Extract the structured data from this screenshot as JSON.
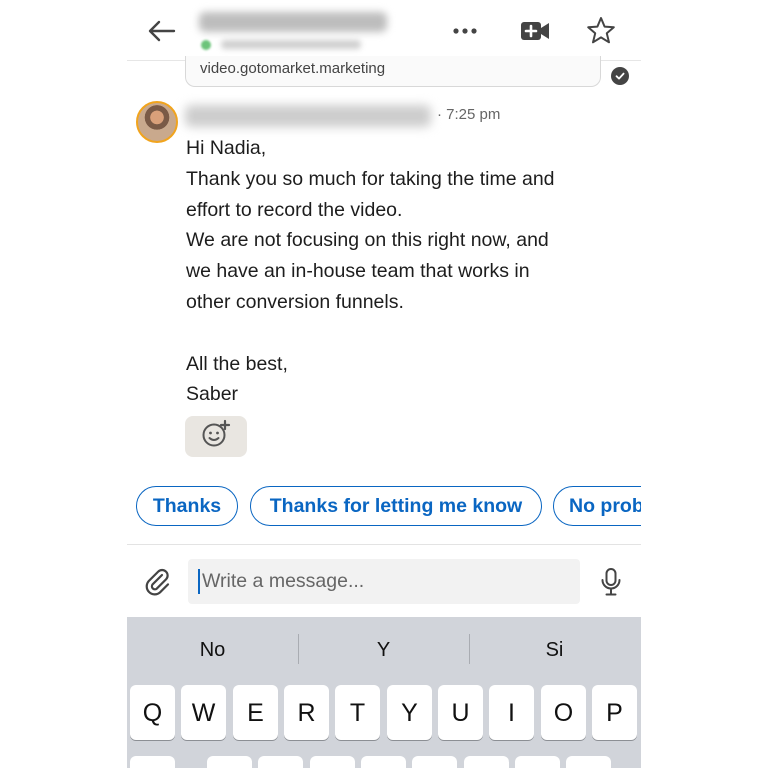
{
  "header": {
    "more_icon": "more-horizontal-icon",
    "video_icon": "video-call-icon",
    "star_icon": "star-icon",
    "back_icon": "arrow-left-icon"
  },
  "conversation": {
    "link_preview_text": "video.gotomarket.marketing",
    "message": {
      "timestamp": "· 7:25 pm",
      "lines": [
        "Hi Nadia,",
        "Thank you so much for taking the time and",
        "effort to record the video.",
        "We are not focusing on this right now, and",
        "we have an in-house team that works in",
        "other conversion funnels.",
        "",
        "All the best,",
        "Saber"
      ]
    }
  },
  "quick_replies": [
    "Thanks",
    "Thanks for letting me know",
    "No prob"
  ],
  "composer": {
    "placeholder": "Write a message...",
    "value": ""
  },
  "keyboard": {
    "suggestions": [
      "No",
      "Y",
      "Si"
    ],
    "row1": [
      "Q",
      "W",
      "E",
      "R",
      "T",
      "Y",
      "U",
      "I",
      "O",
      "P"
    ]
  },
  "colors": {
    "accent": "#0a66c2",
    "avatar_ring": "#f1a41d",
    "keyboard_bg": "#d1d4da"
  }
}
